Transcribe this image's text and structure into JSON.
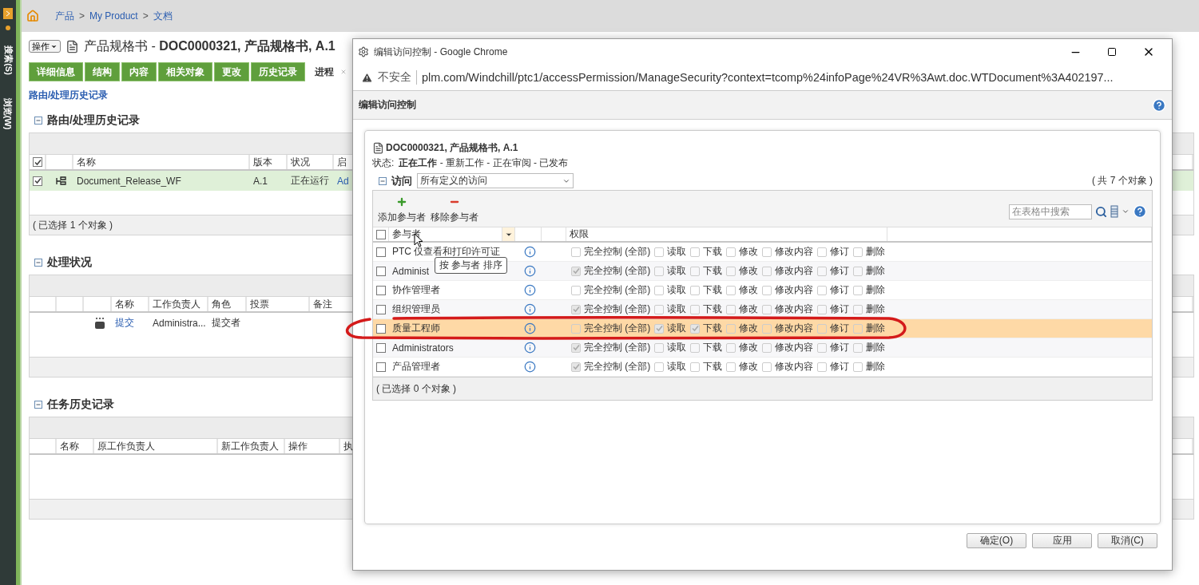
{
  "side_strip": {
    "labels": [
      "搜索(S)",
      "浏览(W)"
    ]
  },
  "breadcrumb": [
    {
      "kind": "link",
      "text": "产品"
    },
    {
      "kind": "separator",
      "text": ">"
    },
    {
      "kind": "link",
      "text": "My Product"
    },
    {
      "kind": "separator",
      "text": ">"
    },
    {
      "kind": "link",
      "text": "文档"
    }
  ],
  "page": {
    "action_button": "操作",
    "title": "产品规格书 - **DOC0000321, 产品规格书, A.1**"
  },
  "tabs": [
    {
      "label": "详细信息",
      "selected": false
    },
    {
      "label": "结构",
      "selected": false
    },
    {
      "label": "内容",
      "selected": false
    },
    {
      "label": "相关对象",
      "selected": false
    },
    {
      "label": "更改",
      "selected": false
    },
    {
      "label": "历史记录",
      "selected": false
    },
    {
      "label": "进程",
      "selected": true
    }
  ],
  "sub_link": "路由/处理历史记录",
  "sections": [
    {
      "title": "路由/处理历史记录",
      "expanded": true,
      "columns": [
        {
          "kind": "check",
          "checked": true
        },
        {
          "kind": "blank"
        },
        {
          "kind": "text",
          "label": "名称"
        },
        {
          "kind": "text",
          "label": "版本"
        },
        {
          "kind": "text",
          "label": "状况"
        },
        {
          "kind": "text",
          "label": "启"
        }
      ],
      "rows": [
        {
          "selected": true,
          "cells": [
            {
              "kind": "check",
              "checked": true
            },
            {
              "kind": "icon"
            },
            {
              "kind": "text",
              "text": "Document_Release_WF"
            },
            {
              "kind": "text",
              "text": "A.1"
            },
            {
              "kind": "text",
              "text": "正在运行"
            },
            {
              "kind": "link",
              "text": "Ad"
            }
          ]
        }
      ],
      "footer": "( 已选择 1 个对象 )"
    },
    {
      "title": "处理状况",
      "expanded": true,
      "columns": [
        {
          "kind": "blank"
        },
        {
          "kind": "blank"
        },
        {
          "kind": "blank"
        },
        {
          "kind": "text",
          "label": "名称"
        },
        {
          "kind": "text",
          "label": "工作负责人"
        },
        {
          "kind": "text",
          "label": "角色"
        },
        {
          "kind": "text",
          "label": "投票"
        },
        {
          "kind": "text",
          "label": "备注"
        }
      ],
      "rows": [
        {
          "selected": false,
          "cells": [
            {
              "kind": "blank"
            },
            {
              "kind": "blank"
            },
            {
              "kind": "icon"
            },
            {
              "kind": "link",
              "text": "提交"
            },
            {
              "kind": "text",
              "text": "Administra..."
            },
            {
              "kind": "text",
              "text": "提交者"
            }
          ]
        }
      ]
    },
    {
      "title": "任务历史记录",
      "expanded": true,
      "columns": [
        {
          "kind": "blank"
        },
        {
          "kind": "text",
          "label": "名称"
        },
        {
          "kind": "text",
          "label": "原工作负责人"
        },
        {
          "kind": "text",
          "label": "新工作负责人"
        },
        {
          "kind": "text",
          "label": "操作"
        },
        {
          "kind": "text",
          "label": "执"
        }
      ]
    }
  ],
  "dialog": {
    "browser_title": "编辑访问控制 - Google Chrome",
    "security": "不安全",
    "url": "plm.com/Windchill/ptc1/accessPermission/ManageSecurity?context=tcomp%24infoPage%24VR%3Awt.doc.WTDocument%3A402197...",
    "header": "编辑访问控制",
    "object": "DOC0000321, 产品规格书, A.1",
    "state_label": "状态:",
    "states": "**正在工作** - 重新工作 - 正在审阅 - 已发布",
    "access_label": "访问",
    "access_expanded": true,
    "access_filter": "所有定义的访问",
    "count": "( 共 7 个对象 )",
    "toolbar": [
      {
        "kind": "add",
        "label": "添加参与者"
      },
      {
        "kind": "remove",
        "label": "移除参与者"
      }
    ],
    "search": {
      "placeholder": "在表格中搜索"
    },
    "columns": {
      "all_checked": false,
      "participant": "参与者",
      "permissions": "权限"
    },
    "rows": [
      {
        "participant": "PTC 仅查看和打印许可证",
        "checked": false,
        "selected": false,
        "permissions": [
          {
            "label": "完全控制 (全部)",
            "checked": false
          },
          {
            "label": "读取",
            "checked": false
          },
          {
            "label": "下载",
            "checked": false
          },
          {
            "label": "修改",
            "checked": false
          },
          {
            "label": "修改内容",
            "checked": false
          },
          {
            "label": "修订",
            "checked": false
          },
          {
            "label": "删除",
            "checked": false
          }
        ]
      },
      {
        "participant": "Administ",
        "checked": false,
        "selected": false,
        "permissions": [
          {
            "label": "完全控制 (全部)",
            "checked": true
          },
          {
            "label": "读取",
            "checked": false
          },
          {
            "label": "下载",
            "checked": false
          },
          {
            "label": "修改",
            "checked": false
          },
          {
            "label": "修改内容",
            "checked": false
          },
          {
            "label": "修订",
            "checked": false
          },
          {
            "label": "删除",
            "checked": false
          }
        ]
      },
      {
        "participant": "协作管理者",
        "checked": false,
        "selected": false,
        "permissions": [
          {
            "label": "完全控制 (全部)",
            "checked": false
          },
          {
            "label": "读取",
            "checked": false
          },
          {
            "label": "下载",
            "checked": false
          },
          {
            "label": "修改",
            "checked": false
          },
          {
            "label": "修改内容",
            "checked": false
          },
          {
            "label": "修订",
            "checked": false
          },
          {
            "label": "删除",
            "checked": false
          }
        ]
      },
      {
        "participant": "组织管理员",
        "checked": false,
        "selected": false,
        "permissions": [
          {
            "label": "完全控制 (全部)",
            "checked": true
          },
          {
            "label": "读取",
            "checked": false
          },
          {
            "label": "下载",
            "checked": false
          },
          {
            "label": "修改",
            "checked": false
          },
          {
            "label": "修改内容",
            "checked": false
          },
          {
            "label": "修订",
            "checked": false
          },
          {
            "label": "删除",
            "checked": false
          }
        ]
      },
      {
        "participant": "质量工程师",
        "checked": false,
        "selected": true,
        "permissions": [
          {
            "label": "完全控制 (全部)",
            "checked": false
          },
          {
            "label": "读取",
            "checked": true
          },
          {
            "label": "下载",
            "checked": true
          },
          {
            "label": "修改",
            "checked": false
          },
          {
            "label": "修改内容",
            "checked": false
          },
          {
            "label": "修订",
            "checked": false
          },
          {
            "label": "删除",
            "checked": false
          }
        ]
      },
      {
        "participant": "Administrators",
        "checked": false,
        "selected": false,
        "permissions": [
          {
            "label": "完全控制 (全部)",
            "checked": true
          },
          {
            "label": "读取",
            "checked": false
          },
          {
            "label": "下载",
            "checked": false
          },
          {
            "label": "修改",
            "checked": false
          },
          {
            "label": "修改内容",
            "checked": false
          },
          {
            "label": "修订",
            "checked": false
          },
          {
            "label": "删除",
            "checked": false
          }
        ]
      },
      {
        "participant": "产品管理者",
        "checked": false,
        "selected": false,
        "permissions": [
          {
            "label": "完全控制 (全部)",
            "checked": true
          },
          {
            "label": "读取",
            "checked": false
          },
          {
            "label": "下载",
            "checked": false
          },
          {
            "label": "修改",
            "checked": false
          },
          {
            "label": "修改内容",
            "checked": false
          },
          {
            "label": "修订",
            "checked": false
          },
          {
            "label": "删除",
            "checked": false
          }
        ]
      }
    ],
    "tooltip": "按 参与者 排序",
    "footer": "( 已选择 0 个对象 )",
    "buttons": [
      "确定(O)",
      "应用",
      "取消(C)"
    ]
  }
}
